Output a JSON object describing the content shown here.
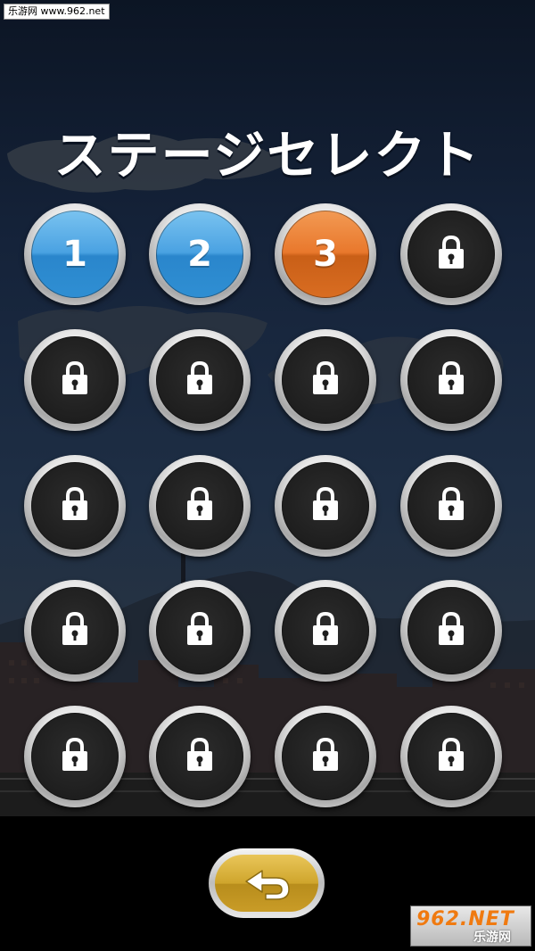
{
  "watermark_top": "乐游网 www.962.net",
  "title": "ステージセレクト",
  "stages": [
    {
      "label": "1",
      "state": "cleared",
      "color": "#4aa2e2"
    },
    {
      "label": "2",
      "state": "cleared",
      "color": "#4aa2e2"
    },
    {
      "label": "3",
      "state": "current",
      "color": "#e9782c"
    },
    {
      "label": "",
      "state": "locked"
    },
    {
      "label": "",
      "state": "locked"
    },
    {
      "label": "",
      "state": "locked"
    },
    {
      "label": "",
      "state": "locked"
    },
    {
      "label": "",
      "state": "locked"
    },
    {
      "label": "",
      "state": "locked"
    },
    {
      "label": "",
      "state": "locked"
    },
    {
      "label": "",
      "state": "locked"
    },
    {
      "label": "",
      "state": "locked"
    },
    {
      "label": "",
      "state": "locked"
    },
    {
      "label": "",
      "state": "locked"
    },
    {
      "label": "",
      "state": "locked"
    },
    {
      "label": "",
      "state": "locked"
    },
    {
      "label": "",
      "state": "locked"
    },
    {
      "label": "",
      "state": "locked"
    },
    {
      "label": "",
      "state": "locked"
    },
    {
      "label": "",
      "state": "locked"
    }
  ],
  "icons": {
    "locked": "lock-icon",
    "back": "back-arrow-icon"
  },
  "colors": {
    "cleared": "#4aa2e2",
    "current": "#e9782c",
    "locked": "#1e1e1e",
    "back_button": "#cfa52c"
  },
  "watermark_bottom": {
    "main": "962.NET",
    "sub": "乐游网"
  }
}
